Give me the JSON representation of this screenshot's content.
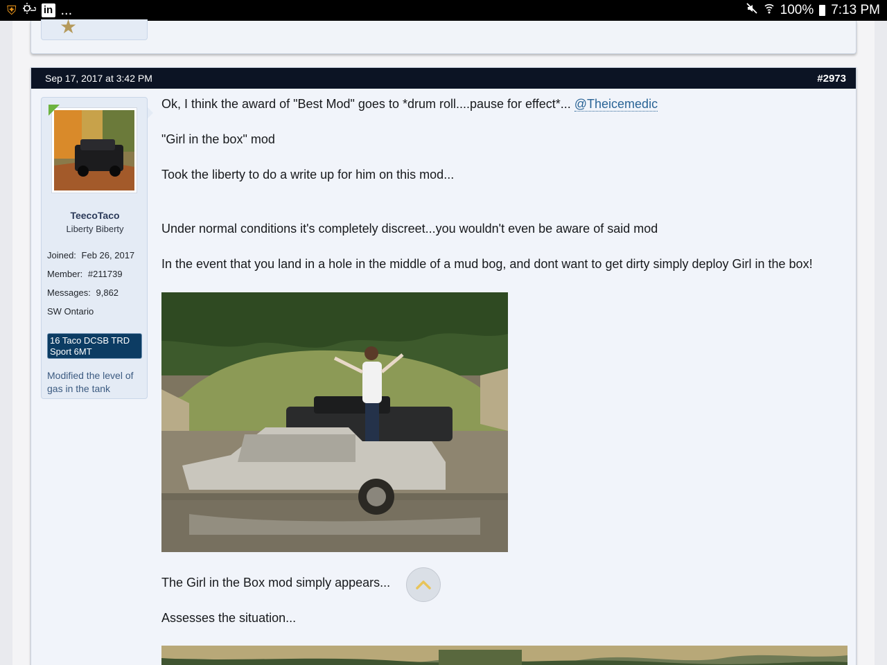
{
  "status_bar": {
    "left_icons": [
      "shield-icon",
      "weather-icon",
      "linkedin-icon"
    ],
    "more": "...",
    "battery": "100%",
    "time": "7:13 PM"
  },
  "post": {
    "date": "Sep 17, 2017 at 3:42 PM",
    "number": "#2973",
    "user": {
      "name": "TeecoTaco",
      "title": "Liberty Biberty",
      "joined_label": "Joined:",
      "joined": "Feb 26, 2017",
      "member_label": "Member:",
      "member": "#211739",
      "messages_label": "Messages:",
      "messages": "9,862",
      "location": "SW Ontario",
      "vehicle": "16 Taco DCSB TRD Sport 6MT",
      "modified": "Modified the level of gas in the tank"
    },
    "body": {
      "line1_prefix": "Ok, I think the award of \"Best Mod\" goes to *drum roll....pause for effect*...",
      "mention": "@Theicemedic",
      "line2": "\"Girl in the box\" mod",
      "line3": "Took the liberty to do a write up for him on this mod...",
      "line4": "Under normal conditions it's completely discreet...you wouldn't even be aware of said mod",
      "line5": "In the event that you land in a hole in the middle of a mud bog, and dont want to get dirty simply deploy Girl in the box!",
      "line6": "The Girl in the Box mod simply appears...",
      "line7": "Assesses the situation..."
    }
  },
  "colors": {
    "header_bg": "#0c1424",
    "post_bg": "#f1f4fa",
    "userbox_bg": "#e4ebf5",
    "vehicle_bg": "#0c3c63",
    "link": "#2a6496"
  }
}
